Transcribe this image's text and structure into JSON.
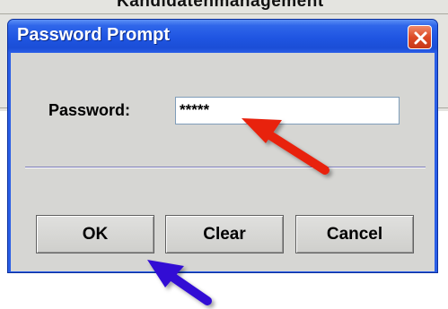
{
  "background_window": {
    "title_fragment": "Kandidatenmanagement"
  },
  "dialog": {
    "title": "Password Prompt",
    "close_icon": "close-x-icon",
    "password_label": "Password:",
    "password_value": "*****",
    "buttons": {
      "ok": "OK",
      "clear": "Clear",
      "cancel": "Cancel"
    }
  },
  "colors": {
    "titlebar": "#1f55e2",
    "close_button": "#dc4a26",
    "dialog_body": "#d6d6d3",
    "red_arrow": "#e8220e",
    "blue_arrow": "#3311d4"
  },
  "annotations": [
    {
      "icon": "red-arrow-icon",
      "points_to": "password-input"
    },
    {
      "icon": "blue-arrow-icon",
      "points_to": "ok-button"
    }
  ]
}
